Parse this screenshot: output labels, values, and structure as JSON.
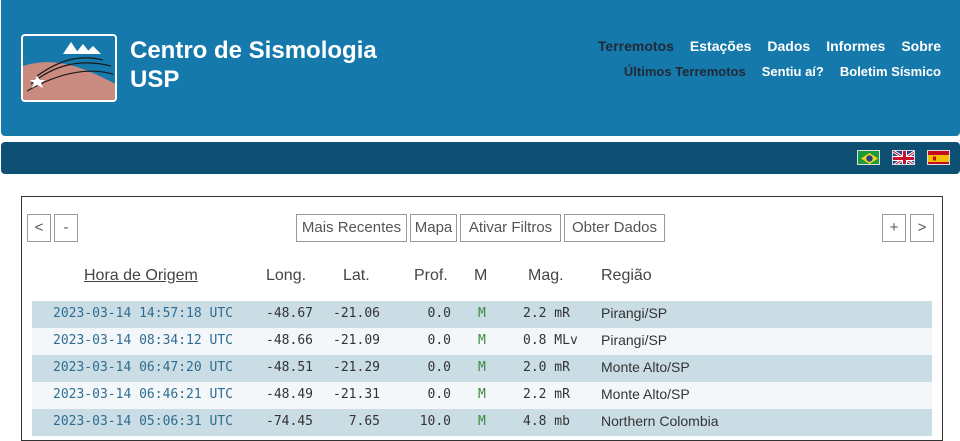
{
  "header": {
    "title_line1": "Centro de Sismologia",
    "title_line2": "USP",
    "nav_top": [
      "Terremotos",
      "Estações",
      "Dados",
      "Informes",
      "Sobre"
    ],
    "nav_bottom": [
      "Últimos Terremotos",
      "Sentiu aí?",
      "Boletim Sísmico"
    ]
  },
  "colors": {
    "header_bg": "#1679ab",
    "bar_bg": "#0e5073",
    "row_odd": "#cadde5",
    "row_even": "#f4f7f9"
  },
  "languages": [
    "brazil-flag",
    "uk-flag",
    "spain-flag"
  ],
  "toolbar": {
    "prev": "<",
    "minus": "-",
    "recent": "Mais Recentes",
    "map": "Mapa",
    "filters": "Ativar Filtros",
    "get_data": "Obter Dados",
    "plus": "+",
    "next": ">"
  },
  "table": {
    "headers": [
      "Hora de Origem",
      "Long.",
      "Lat.",
      "Prof.",
      "M",
      "Mag.",
      "Região"
    ],
    "rows": [
      {
        "time": "2023-03-14 14:57:18 UTC",
        "lon": "-48.67",
        "lat": "-21.06",
        "depth": "0.0",
        "m": "M",
        "mag": "2.2 mR",
        "region": "Pirangi/SP"
      },
      {
        "time": "2023-03-14 08:34:12 UTC",
        "lon": "-48.66",
        "lat": "-21.09",
        "depth": "0.0",
        "m": "M",
        "mag": "0.8 MLv",
        "region": "Pirangi/SP"
      },
      {
        "time": "2023-03-14 06:47:20 UTC",
        "lon": "-48.51",
        "lat": "-21.29",
        "depth": "0.0",
        "m": "M",
        "mag": "2.0 mR",
        "region": "Monte Alto/SP"
      },
      {
        "time": "2023-03-14 06:46:21 UTC",
        "lon": "-48.49",
        "lat": "-21.31",
        "depth": "0.0",
        "m": "M",
        "mag": "2.2 mR",
        "region": "Monte Alto/SP"
      },
      {
        "time": "2023-03-14 05:06:31 UTC",
        "lon": "-74.45",
        "lat": "7.65",
        "depth": "10.0",
        "m": "M",
        "mag": "4.8 mb",
        "region": "Northern Colombia"
      }
    ]
  }
}
